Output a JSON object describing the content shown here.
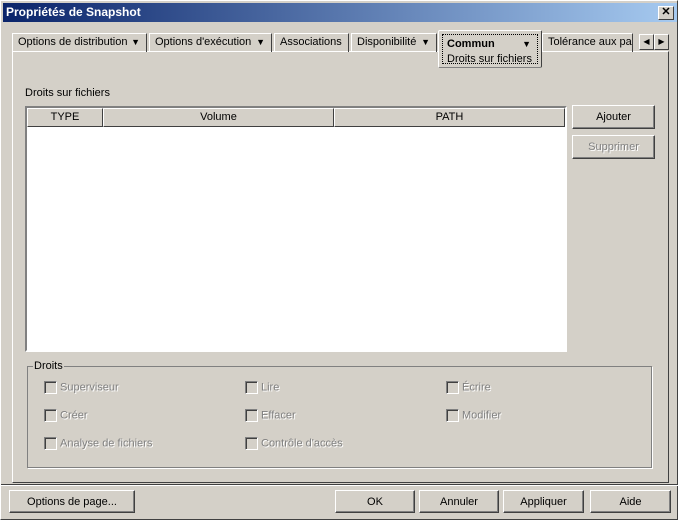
{
  "window": {
    "title": "Propriétés de Snapshot",
    "close": "✕"
  },
  "tabs": [
    {
      "label": "Options de distribution",
      "arrow": "▼"
    },
    {
      "label": "Options d'exécution",
      "arrow": "▼"
    },
    {
      "label": "Associations"
    },
    {
      "label": "Disponibilité",
      "arrow": "▼"
    },
    {
      "label": "Commun",
      "sub": "Droits sur fichiers",
      "arrow": "▼"
    },
    {
      "label": "Tolérance aux pa"
    }
  ],
  "scroll": {
    "left": "◀",
    "right": "▶"
  },
  "section_label": "Droits sur fichiers",
  "table": {
    "columns": [
      "TYPE",
      "Volume",
      "PATH"
    ],
    "rows": []
  },
  "buttons": {
    "add": "Ajouter",
    "remove": "Supprimer",
    "page_options": "Options de page...",
    "ok": "OK",
    "cancel": "Annuler",
    "apply": "Appliquer",
    "help": "Aide"
  },
  "rights": {
    "label": "Droits",
    "items": [
      "Superviseur",
      "Lire",
      "Écrire",
      "Créer",
      "Effacer",
      "Modifier",
      "Analyse de fichiers",
      "Contrôle d'accès"
    ]
  }
}
